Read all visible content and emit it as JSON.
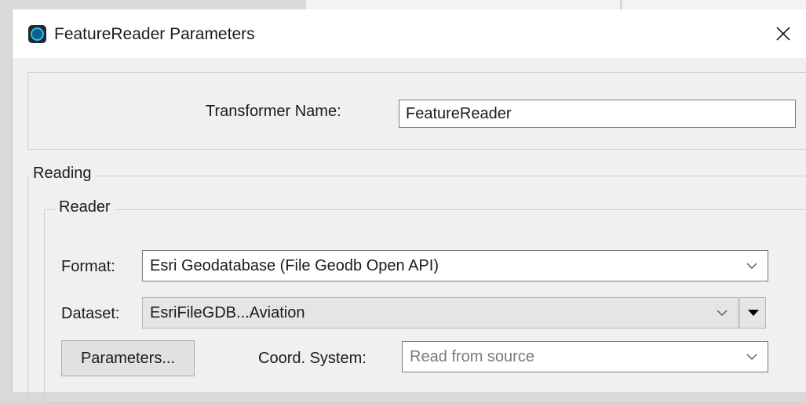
{
  "window": {
    "title": "FeatureReader Parameters",
    "app_icon": "fme-app-icon",
    "close_icon": "close-icon"
  },
  "transformer": {
    "name_label": "Transformer Name:",
    "name_value": "FeatureReader"
  },
  "reading": {
    "group_label": "Reading",
    "reader": {
      "group_label": "Reader",
      "format_label": "Format:",
      "format_value": "Esri Geodatabase (File Geodb Open API)",
      "dataset_label": "Dataset:",
      "dataset_value": "EsriFileGDB...Aviation",
      "parameters_button": "Parameters...",
      "coord_label": "Coord. System:",
      "coord_placeholder": "Read from source"
    }
  },
  "colors": {
    "dialog_bg": "#f0f0f0",
    "titlebar_bg": "#ffffff",
    "icon_accent": "#29c1ea"
  }
}
